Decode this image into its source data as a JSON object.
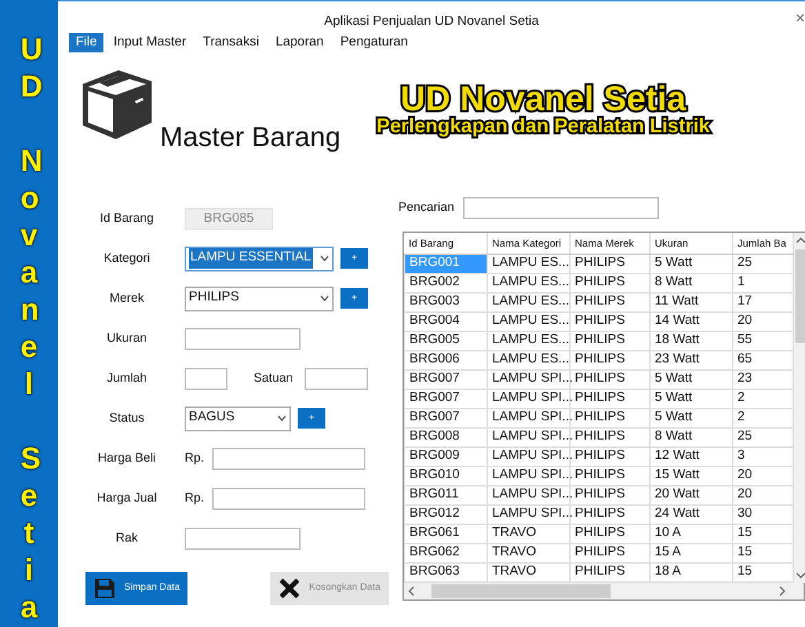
{
  "sidebar": {
    "words": [
      "UD",
      "Novanel",
      "Setia"
    ]
  },
  "window": {
    "title": "Aplikasi Penjualan UD Novanel Setia",
    "close": "×"
  },
  "menu": [
    {
      "label": "File",
      "selected": true
    },
    {
      "label": "Input Master",
      "selected": false
    },
    {
      "label": "Transaksi",
      "selected": false
    },
    {
      "label": "Laporan",
      "selected": false
    },
    {
      "label": "Pengaturan",
      "selected": false
    }
  ],
  "header": {
    "title": "Master Barang",
    "brand": "UD Novanel Setia",
    "tagline": "Perlengkapan dan Peralatan Listrik"
  },
  "form": {
    "fields": [
      {
        "kind": "text",
        "label": "Id Barang",
        "value": "BRG085",
        "disabled": true
      },
      {
        "kind": "select",
        "label": "Kategori",
        "value": "LAMPU ESSENTIAL",
        "highlighted": true,
        "add_button": "+"
      },
      {
        "kind": "select",
        "label": "Merek",
        "value": "PHILIPS",
        "highlighted": false,
        "add_button": "+"
      },
      {
        "kind": "text",
        "label": "Ukuran",
        "disabled": false
      },
      {
        "kind": "pair",
        "label": "Jumlah",
        "label_2": "Satuan"
      },
      {
        "kind": "status",
        "label": "Status",
        "value": "BAGUS",
        "highlighted": false,
        "add_button": "+"
      },
      {
        "kind": "money",
        "label": "Harga Beli",
        "prefix": "Rp."
      },
      {
        "kind": "money",
        "label": "Harga Jual",
        "prefix": "Rp."
      },
      {
        "kind": "text",
        "label": "Rak",
        "disabled": false
      }
    ],
    "buttons": [
      {
        "kind": "save",
        "label": "Simpan Data",
        "disabled": false
      },
      {
        "kind": "clear",
        "label": "Kosongkan Data",
        "disabled": true
      }
    ]
  },
  "search": {
    "label": "Pencarian"
  },
  "table": {
    "columns": [
      "Id Barang",
      "Nama Kategori",
      "Nama Merek",
      "Ukuran",
      "Jumlah Ba"
    ],
    "rows": [
      {
        "cells": [
          "BRG001",
          "LAMPU ES...",
          "PHILIPS",
          "5 Watt",
          "25"
        ],
        "selected": true
      },
      {
        "cells": [
          "BRG002",
          "LAMPU ES...",
          "PHILIPS",
          "8 Watt",
          "1"
        ],
        "selected": false
      },
      {
        "cells": [
          "BRG003",
          "LAMPU ES...",
          "PHILIPS",
          "11 Watt",
          "17"
        ],
        "selected": false
      },
      {
        "cells": [
          "BRG004",
          "LAMPU ES...",
          "PHILIPS",
          "14 Watt",
          "20"
        ],
        "selected": false
      },
      {
        "cells": [
          "BRG005",
          "LAMPU ES...",
          "PHILIPS",
          "18 Watt",
          "55"
        ],
        "selected": false
      },
      {
        "cells": [
          "BRG006",
          "LAMPU ES...",
          "PHILIPS",
          "23 Watt",
          "65"
        ],
        "selected": false
      },
      {
        "cells": [
          "BRG007",
          "LAMPU SPI...",
          "PHILIPS",
          "5 Watt",
          "23"
        ],
        "selected": false
      },
      {
        "cells": [
          "BRG007",
          "LAMPU SPI...",
          "PHILIPS",
          "5 Watt",
          "2"
        ],
        "selected": false
      },
      {
        "cells": [
          "BRG007",
          "LAMPU SPI...",
          "PHILIPS",
          "5 Watt",
          "2"
        ],
        "selected": false
      },
      {
        "cells": [
          "BRG008",
          "LAMPU SPI...",
          "PHILIPS",
          "8 Watt",
          "25"
        ],
        "selected": false
      },
      {
        "cells": [
          "BRG009",
          "LAMPU SPI...",
          "PHILIPS",
          "12 Watt",
          "3"
        ],
        "selected": false
      },
      {
        "cells": [
          "BRG010",
          "LAMPU SPI...",
          "PHILIPS",
          "15 Watt",
          "20"
        ],
        "selected": false
      },
      {
        "cells": [
          "BRG011",
          "LAMPU SPI...",
          "PHILIPS",
          "20 Watt",
          "20"
        ],
        "selected": false
      },
      {
        "cells": [
          "BRG012",
          "LAMPU SPI...",
          "PHILIPS",
          "24 Watt",
          "30"
        ],
        "selected": false
      },
      {
        "cells": [
          "BRG061",
          "TRAVO",
          "PHILIPS",
          "10 A",
          "15"
        ],
        "selected": false
      },
      {
        "cells": [
          "BRG062",
          "TRAVO",
          "PHILIPS",
          "15 A",
          "15"
        ],
        "selected": false
      },
      {
        "cells": [
          "BRG063",
          "TRAVO",
          "PHILIPS",
          "18 A",
          "15"
        ],
        "selected": false
      }
    ]
  }
}
